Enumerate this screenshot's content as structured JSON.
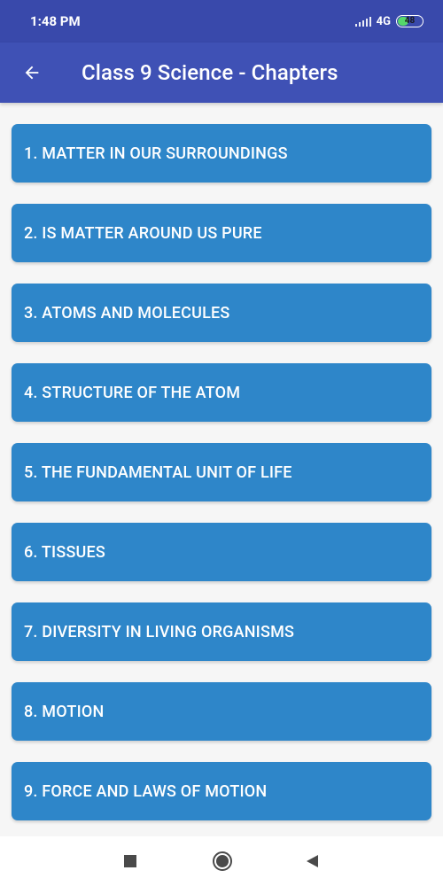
{
  "status_bar": {
    "time": "1:48 PM",
    "network": "4G",
    "battery": "48",
    "battery_level": 0.48,
    "signal_icon": "signal-icon",
    "battery_color": "#55d86a"
  },
  "app_bar": {
    "title": "Class 9 Science - Chapters",
    "back_icon": "arrow-left-icon",
    "background": "#3f51b5"
  },
  "chapters": [
    "1. MATTER IN OUR SURROUNDINGS",
    "2. IS MATTER AROUND US PURE",
    "3. ATOMS AND MOLECULES",
    "4. STRUCTURE OF THE ATOM",
    "5. THE FUNDAMENTAL UNIT OF LIFE",
    "6. TISSUES",
    "7. DIVERSITY IN LIVING ORGANISMS",
    "8. MOTION",
    "9. FORCE AND LAWS OF MOTION"
  ],
  "colors": {
    "accent": "#2e86c9",
    "status_bar": "#3949ab"
  },
  "nav_bar": {
    "icons": [
      "recents-square-icon",
      "home-circle-icon",
      "back-triangle-icon"
    ]
  }
}
